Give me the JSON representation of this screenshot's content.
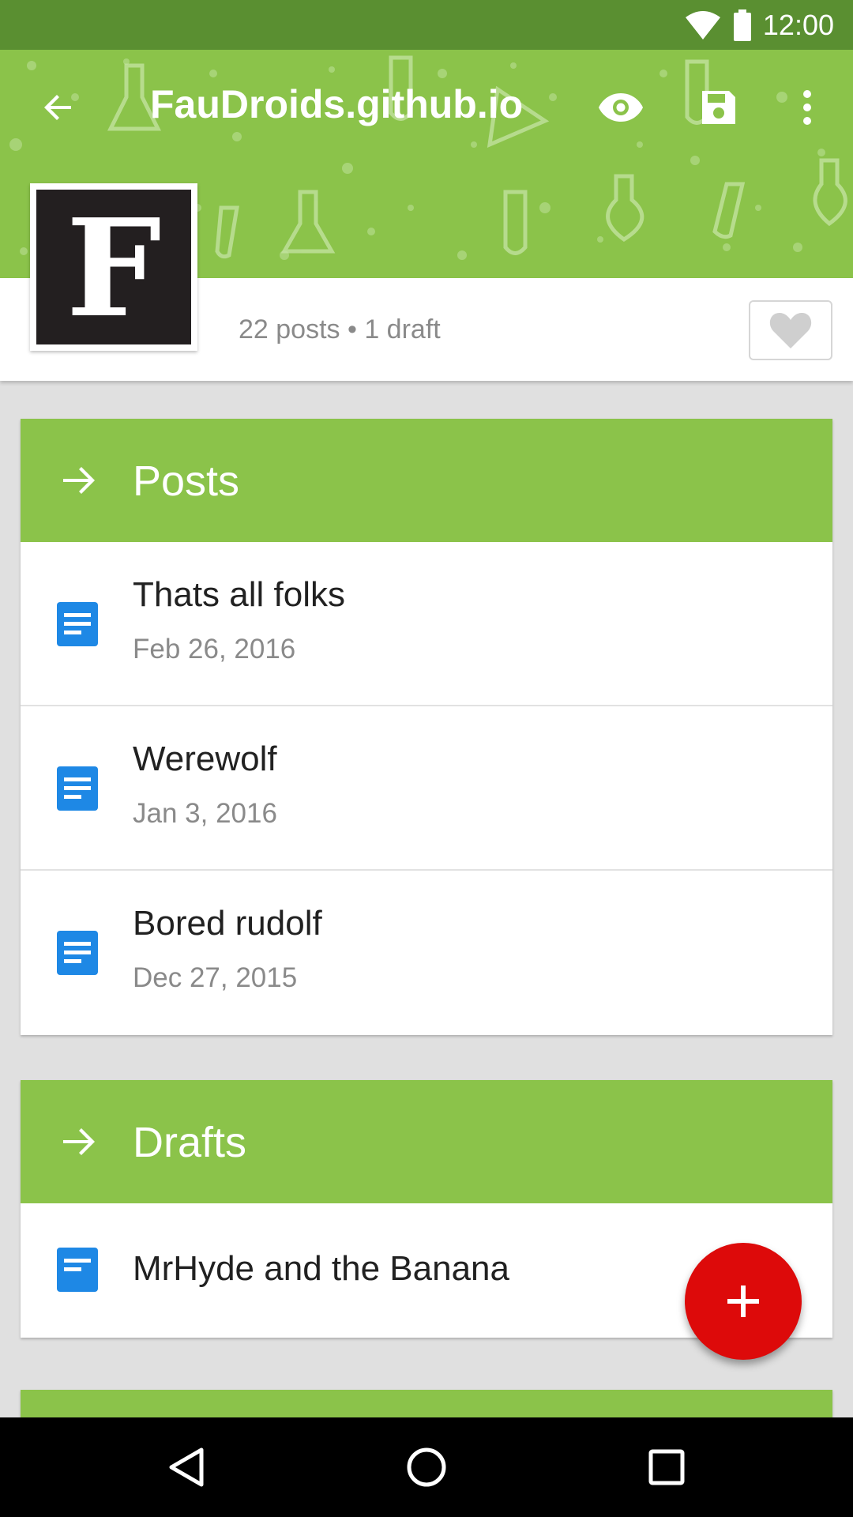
{
  "status_bar": {
    "time": "12:00",
    "icons": [
      "wifi-icon",
      "battery-icon"
    ]
  },
  "toolbar": {
    "title": "FauDroids.github.io",
    "icons": [
      "back-arrow-icon",
      "eye-icon",
      "save-icon",
      "more-vert-icon"
    ]
  },
  "profile": {
    "avatar_letter": "F",
    "post_count": "22 posts • 1 draft",
    "favorite_icon": "heart-icon"
  },
  "posts": {
    "header": "Posts",
    "items": [
      {
        "title": "Thats all folks",
        "date": "Feb 26, 2016"
      },
      {
        "title": "Werewolf",
        "date": "Jan 3, 2016"
      },
      {
        "title": "Bored rudolf",
        "date": "Dec 27, 2015"
      }
    ]
  },
  "drafts": {
    "header": "Drafts",
    "items": [
      {
        "title": "MrHyde and the Banana"
      }
    ]
  },
  "fab": {
    "icon": "plus-icon"
  },
  "nav": {
    "icons": [
      "back-triangle-icon",
      "home-circle-icon",
      "recents-square-icon"
    ]
  },
  "colors": {
    "status_bar": "#5a8f31",
    "primary": "#8bc34a",
    "accent": "#dd0a0a",
    "doc_icon": "#1e88e5"
  }
}
